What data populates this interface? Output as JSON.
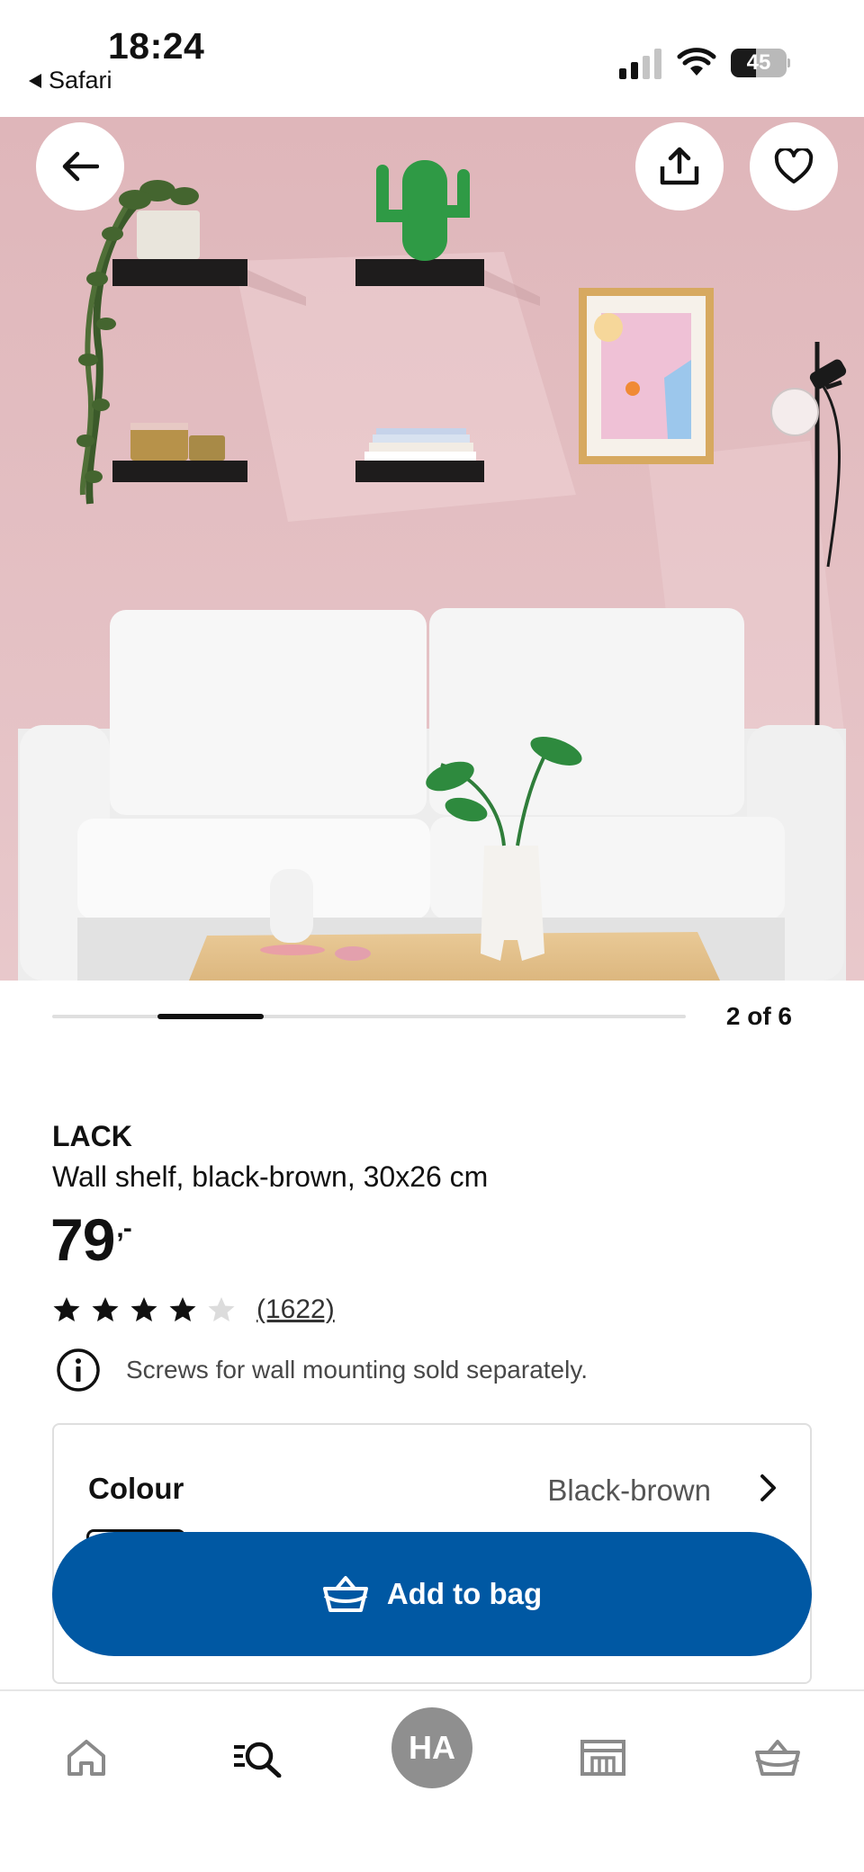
{
  "status_bar": {
    "time": "18:24",
    "back_app": "Safari",
    "battery_level": "45"
  },
  "hero": {
    "back_icon": "arrow-left-icon",
    "share_icon": "share-icon",
    "favourite_icon": "heart-icon",
    "current_image": 2,
    "total_images": 6,
    "counter_text": "2 of 6"
  },
  "product": {
    "name": "LACK",
    "description": "Wall shelf, black-brown, 30x26 cm",
    "price": "79",
    "price_suffix": ",-",
    "rating": 4,
    "rating_max": 5,
    "review_count": "(1622)",
    "info_text": "Screws for wall mounting sold separately."
  },
  "colour": {
    "label": "Colour",
    "value": "Black-brown"
  },
  "actions": {
    "add_to_bag": "Add to bag"
  },
  "bottom_nav": {
    "items": [
      "home-icon",
      "search-icon",
      "profile-avatar",
      "store-icon",
      "basket-icon"
    ],
    "avatar_initials": "HA"
  },
  "colors": {
    "accent_blue": "#0058a3",
    "wall_pink": "#e3bfc3",
    "star_filled": "#111111",
    "star_empty": "#dcdcdc"
  }
}
